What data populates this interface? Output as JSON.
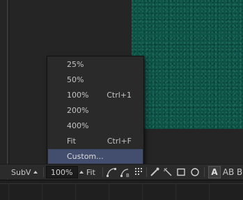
{
  "zoom_menu": {
    "items": [
      {
        "label": "25%",
        "shortcut": ""
      },
      {
        "label": "50%",
        "shortcut": ""
      },
      {
        "label": "100%",
        "shortcut": "Ctrl+1"
      },
      {
        "label": "200%",
        "shortcut": ""
      },
      {
        "label": "400%",
        "shortcut": ""
      },
      {
        "label": "Fit",
        "shortcut": "Ctrl+F"
      },
      {
        "label": "Custom...",
        "shortcut": ""
      }
    ],
    "highlighted_item": "Custom..."
  },
  "toolbar": {
    "subview_label": "SubV",
    "zoom_value": "100%",
    "fit_label": "Fit",
    "text_a_label": "A",
    "text_ab_label": "AB",
    "text_b_label": "B"
  },
  "colors": {
    "viewer_image": "#0e5348",
    "menu_highlight": "#434d6e"
  }
}
